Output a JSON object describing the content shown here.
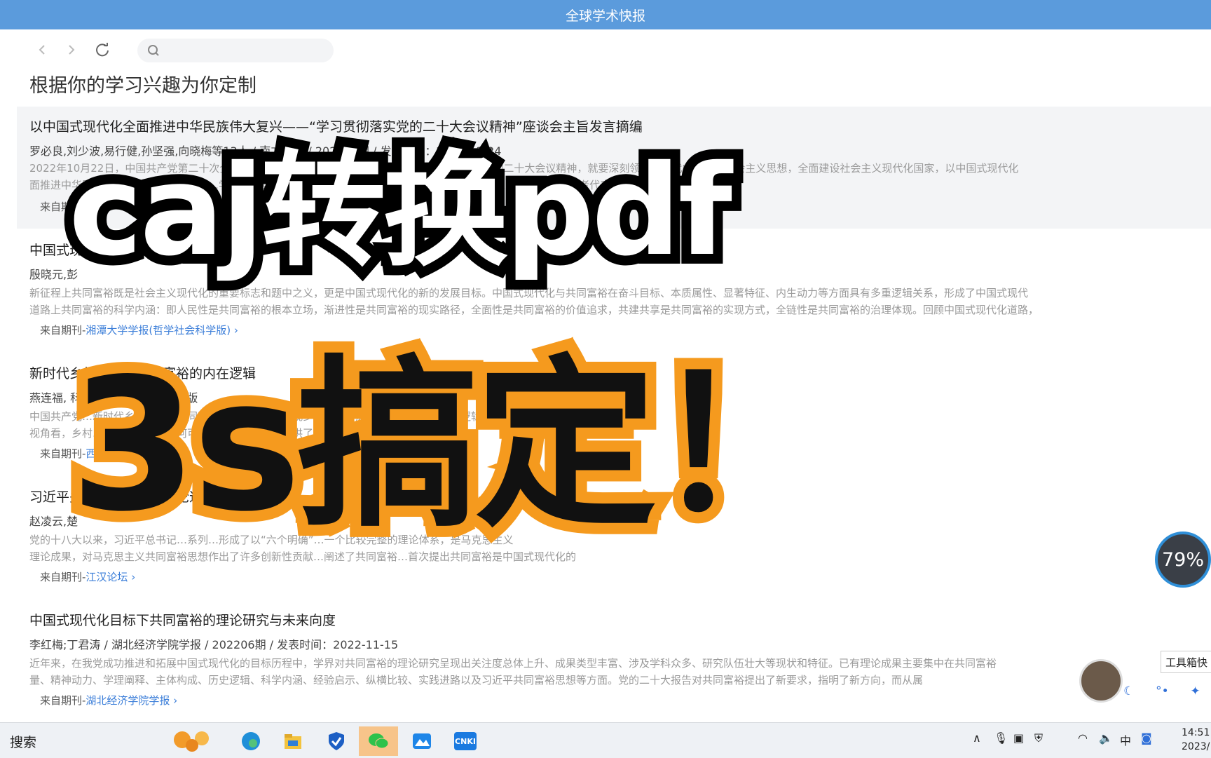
{
  "window": {
    "title": "全球学术快报"
  },
  "nav": {
    "search_placeholder": ""
  },
  "page": {
    "heading": "根据你的学习兴趣为你定制"
  },
  "articles": [
    {
      "title": "以中国式现代化全面推进中华民族伟大复兴——“学习贯彻落实党的二十大会议精神”座谈会主旨发言摘编",
      "meta": "罗必良,刘少波,易行健,孙坚强,向晓梅等13人 / 南方经济 / 202211期 / 发表时间：2022-11-24",
      "abstract1": "2022年10月22日，中国共产党第二十次全国代表大会在北京胜利闭幕。新时代新征程，学习贯彻党的二十大会议精神，就要深刻领会新时代中国特色社会主义思想，全面建设社会主义现代化国家，以中国式现代化",
      "abstract2": "面推进中华民族伟大复兴。…本刊特邀…学习贯彻党的二十大会议精神…的13位广东经济学界知名专家与优秀中青年学者代表围绕“二十大”报告中",
      "source_prefix": "来自期刊-",
      "source": ""
    },
    {
      "title": "中国式现代化与共同富裕",
      "meta": "殷晓元,彭",
      "abstract1": "新征程上共同富裕既是社会主义现代化的重要标志和题中之义，更是中国式现代化的新的发展目标。中国式现代化与共同富裕在奋斗目标、本质属性、显著特征、内生动力等方面具有多重逻辑关系，形成了中国式现代",
      "abstract2": "道路上共同富裕的科学内涵：即人民性是共同富裕的根本立场，渐进性是共同富裕的现实路径，全面性是共同富裕的价值追求，共建共享是共同富裕的实现方式，全链性是共同富裕的治理体现。回顾中国式现代化道路，",
      "source_prefix": "来自期刊-",
      "source": "湘潭大学学报(哲学社会科学版)"
    },
    {
      "title": "新时代乡村振兴与共同富裕的内在逻辑",
      "meta": "燕连福,                                                    科技大学学报(社会科学版",
      "abstract1": "中国共产党…新时代乡村振兴与共同富裕…从新的视角审视乡村振兴…深刻理解二者之间内在逻辑关系。首先，从“何以可能”",
      "abstract2": "视角看，乡村…提供了目标…从何可能…精为乡村振兴提供了方向指引，主要表现为共同富裕的",
      "source_prefix": "来自期刊-",
      "source": "西北农"
    },
    {
      "title": "习近平关于共同富裕重要论述",
      "meta": "赵凌云,楚",
      "abstract1": "党的十八大以来，习近平总书记…系列…形成了以“六个明确”…一个比较完整的理论体系，是马克思主义",
      "abstract2": "理论成果，对马克思主义共同富裕思想作出了许多创新性贡献…阐述了共同富裕…首次提出共同富裕是中国式现代化的",
      "source_prefix": "来自期刊-",
      "source": "江汉论坛"
    },
    {
      "title": "中国式现代化目标下共同富裕的理论研究与未来向度",
      "meta": "李红梅;丁君涛 / 湖北经济学院学报 / 202206期 / 发表时间：2022-11-15",
      "abstract1": "近年来，在我党成功推进和拓展中国式现代化的目标历程中，学界对共同富裕的理论研究呈现出关注度总体上升、成果类型丰富、涉及学科众多、研究队伍壮大等现状和特征。已有理论成果主要集中在共同富裕",
      "abstract2": "量、精神动力、学理阐释、主体构成、历史逻辑、科学内涵、经验启示、纵横比较、实践进路以及习近平共同富裕思想等方面。党的二十大报告对共同富裕提出了新要求，指明了新方向，而从属",
      "source_prefix": "来自期刊-",
      "source": "湖北经济学院学报"
    }
  ],
  "overlay": {
    "line1": "caj转换pdf",
    "line2": "3s搞定！"
  },
  "widgets": {
    "progress_percent": 79,
    "progress_label": "79%",
    "toolbox_label": "工具箱快",
    "ime_lang": "中"
  },
  "taskbar": {
    "search_label": "搜索",
    "apps": [
      "edge-icon",
      "file-explorer-icon",
      "security-icon",
      "wechat-icon",
      "photos-icon",
      "cnki-icon"
    ],
    "cnki_label": "CNKI",
    "tray_lang": "中",
    "clock_time": "14:51",
    "clock_date": "2023/"
  },
  "colors": {
    "titlebar": "#5b9bdc",
    "link": "#3d7fd9",
    "overlay_stroke1": "#000000",
    "overlay_stroke2": "#f59a1e"
  }
}
